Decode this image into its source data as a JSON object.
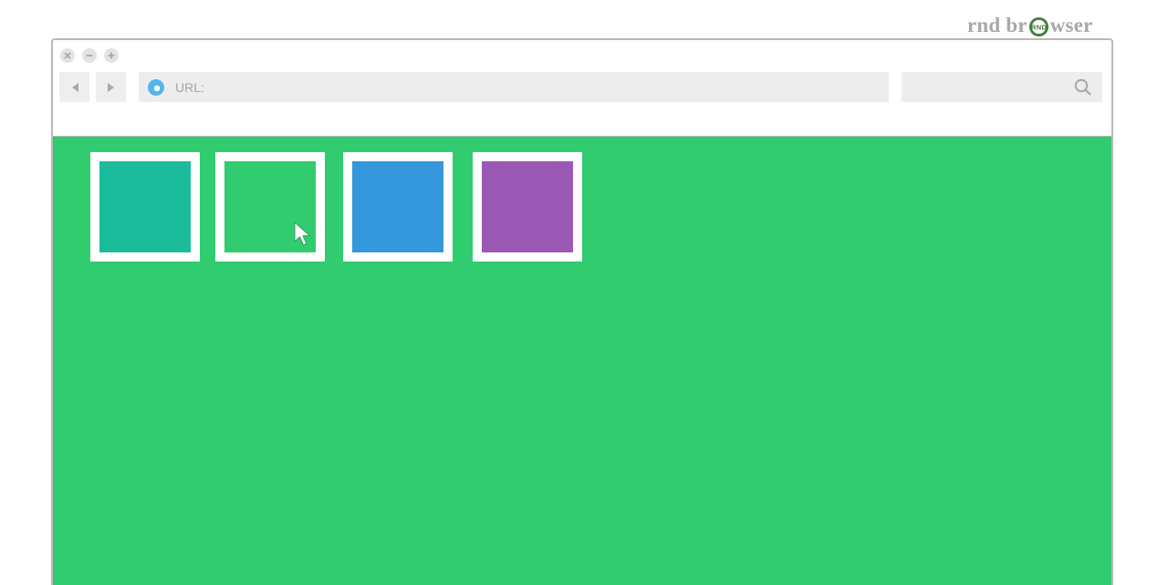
{
  "brand": {
    "logo_part1": "rnd br",
    "logo_part2": "wser",
    "badge_text": "RND"
  },
  "toolbar": {
    "url_label": "URL:",
    "url_value": "",
    "search_value": ""
  },
  "icons": {
    "close": "close-icon",
    "minimize": "minimize-icon",
    "maximize": "maximize-icon",
    "back": "back-arrow-icon",
    "forward": "forward-arrow-icon",
    "site": "site-icon",
    "search": "search-icon",
    "cursor": "mouse-pointer-icon"
  },
  "content": {
    "background": "#31cc70",
    "tiles": [
      {
        "color": "#1abc9c"
      },
      {
        "color": "#31cc70"
      },
      {
        "color": "#3598dc"
      },
      {
        "color": "#9b59b6"
      }
    ]
  }
}
